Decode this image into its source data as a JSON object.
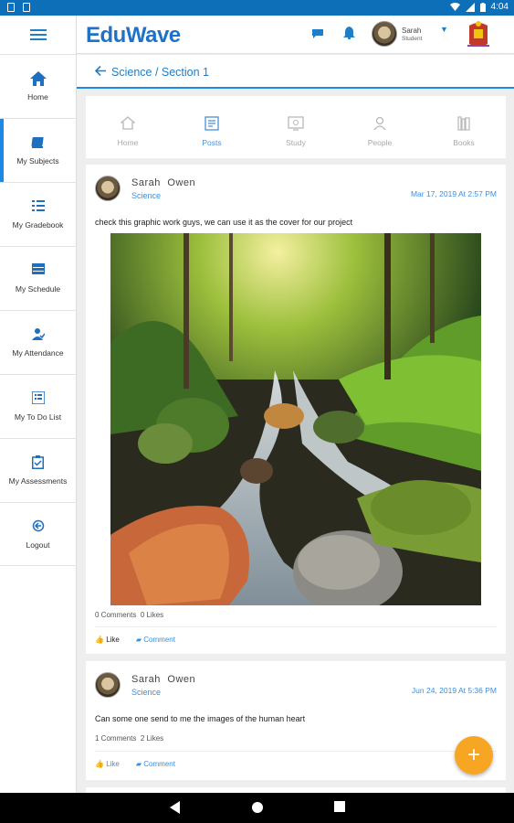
{
  "status_bar": {
    "time": "4:04"
  },
  "app": {
    "logo": "EduWave"
  },
  "user": {
    "name": "Sarah",
    "role": "Student"
  },
  "sidebar": {
    "items": [
      {
        "label": "Home",
        "icon": "home-icon"
      },
      {
        "label": "My Subjects",
        "icon": "book-icon",
        "active": true
      },
      {
        "label": "My Gradebook",
        "icon": "list-icon"
      },
      {
        "label": "My Schedule",
        "icon": "table-icon"
      },
      {
        "label": "My Attendance",
        "icon": "person-check-icon"
      },
      {
        "label": "My To Do List",
        "icon": "checklist-icon"
      },
      {
        "label": "My Assessments",
        "icon": "clipboard-icon"
      },
      {
        "label": "Logout",
        "icon": "logout-icon"
      }
    ]
  },
  "breadcrumb": "Science / Section 1",
  "tabs": [
    {
      "label": "Home",
      "icon": "home-icon"
    },
    {
      "label": "Posts",
      "icon": "posts-icon",
      "active": true
    },
    {
      "label": "Study",
      "icon": "study-icon"
    },
    {
      "label": "People",
      "icon": "people-icon"
    },
    {
      "label": "Books",
      "icon": "books-icon"
    }
  ],
  "posts": [
    {
      "author": "Sarah Owen",
      "subject": "Science",
      "date": "Mar 17, 2019 At 2:57 PM",
      "text": "check this graphic work guys, we can use it as the cover for our project",
      "comments": "0 Comments",
      "likes": "0 Likes",
      "like_label": "Like",
      "comment_label": "Comment"
    },
    {
      "author": "Sarah Owen",
      "subject": "Science",
      "date": "Jun 24, 2019 At 5:36 PM",
      "text": "Can some one send to me the images of the human heart",
      "comments": "1 Comments",
      "likes": "2 Likes",
      "like_label": "Like",
      "comment_label": "Comment"
    }
  ],
  "fab": "+",
  "colors": {
    "primary": "#1e7ec8",
    "accent": "#f6a623",
    "status_bar": "#0d6fb8"
  }
}
